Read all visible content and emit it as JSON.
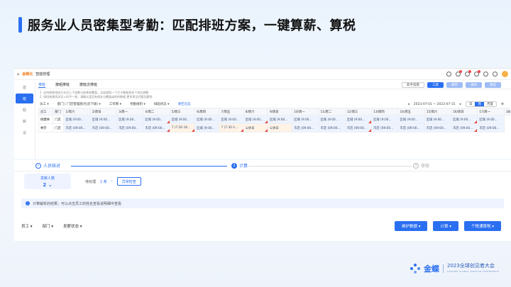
{
  "slide": {
    "title": "服务业人员密集型考勤：匹配排班方案，一键算薪、算税"
  },
  "app": {
    "brand": "金蝶云",
    "module": "智能管理",
    "nav": [
      "首",
      "班",
      "假",
      "薪",
      "设"
    ],
    "tabs": [
      "排班",
      "按组排班",
      "按班次排班"
    ],
    "toolbar": {
      "new_guide": "新手指南",
      "tools": "工具",
      "save": "保存",
      "publish": "发布",
      "preview": "预览"
    },
    "notes": [
      "1. 支持按照排班方式对上下班数与结果有覆盖，全局按照一个打卡数据表多个排次调整",
      "2. 排班结果再次导入时不一致，请确认是否有保存与覆盖或的的数据 更多常见问题及解答"
    ],
    "filters": [
      "员工 ▾",
      "部门 | 门店管理部(包含下级) ▾",
      "工作制 ▾",
      "考勤组织 ▾",
      "排班状态 ▾"
    ],
    "filter_link": "清空已选",
    "date_range": "2023-07-01 ~ 2023-07-31",
    "view_modes": [
      "日",
      "周",
      "月度"
    ],
    "grid_headers": [
      "员工",
      "部门",
      "1/周六",
      "2/周日",
      "3/周一",
      "4/周二",
      "5/周三",
      "6/周四",
      "7/周五",
      "8/周六",
      "9/周日",
      "10/周一",
      "11/周二",
      "12/周三",
      "13/周四",
      "14/周五",
      "15/周六",
      "16/周日",
      "17/周一",
      "18/周二"
    ],
    "grid_rows": [
      {
        "name": "杨建林",
        "dept": "门店",
        "cells": [
          "区域 (9:00...",
          "区域 (9:00...",
          "区域 (9:00...",
          "区域 (9:00...",
          "区域 (9:00...",
          "区域 (9:00...",
          "区域 (9:00...",
          "区域 (9:00...",
          "区域 (9:00...",
          "区域 (9:00...",
          "区域 (9:00...",
          "区域 (9:00...",
          "区域 (9:00...",
          "区域 (9:00...",
          "区域 (9:00...",
          "区域 (9:00...",
          "区域 (9:00..."
        ]
      },
      {
        "name": "林芳",
        "dept": "门店",
        "cells": [
          "市店 (09:00...",
          "市店 (09:00...",
          "市店 (09:00...",
          "市店 (09:00...",
          "7 (7:30-16...",
          "区域 (9:00...",
          "7 (7:30-1...",
          "公休日",
          "公休日",
          "市店 (09:00...",
          "市店 (09:00...",
          "市店 (09:00...",
          "市店 (09:00...",
          "市店 (09:00...",
          "市店 (09:00...",
          "市店 (09:00...",
          "市店 (09:00..."
        ]
      }
    ]
  },
  "payroll": {
    "steps": [
      "人员核对",
      "计算",
      "审核"
    ],
    "step_nums": [
      "✓",
      "2",
      "3"
    ],
    "count_label": "发薪人数",
    "count_value": "2 ⌄",
    "pending_label": "待处理",
    "pending_count": "1 条",
    "pending_arrow": "›",
    "exception_button": "异常检查",
    "tip": "计算解析的结果，可以点击员工的姓名查看说明细中查看",
    "filters": [
      "员工 ▾",
      "部门 ▾",
      "发薪状态 ▾"
    ],
    "actions": [
      "维护数据 ▾",
      "计算 ▾",
      "个税通算税 ▾"
    ]
  },
  "footer": {
    "brand": "金蝶",
    "conference": "2023全球创见者大会",
    "conference_en": "KINGDEE GLOBAL CREATOR CONFERENCE"
  },
  "colors": {
    "accent": "#2a6ff0",
    "warning": "#e8443a"
  }
}
